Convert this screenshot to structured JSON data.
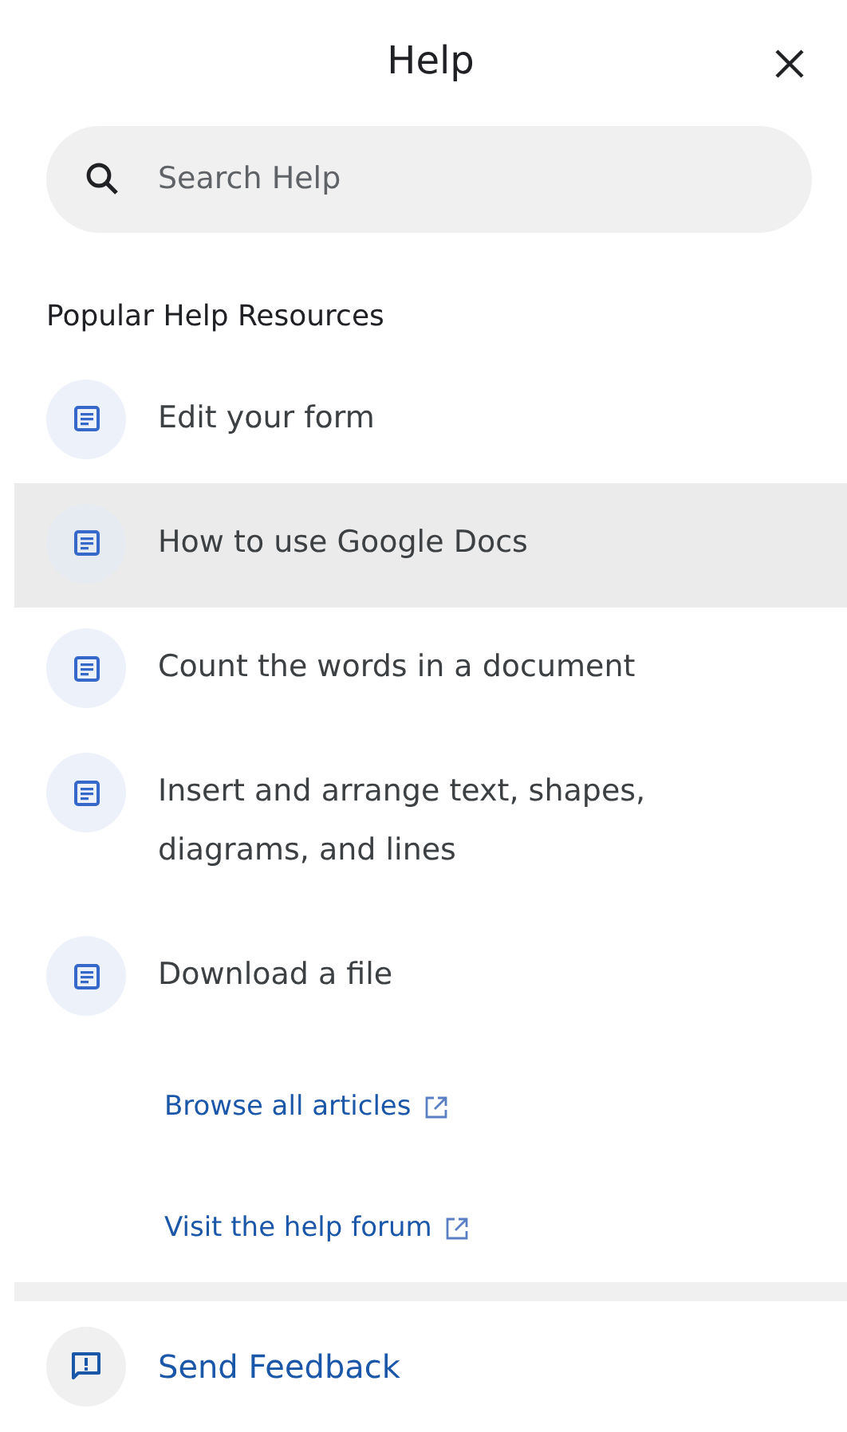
{
  "header": {
    "title": "Help"
  },
  "search": {
    "placeholder": "Search Help"
  },
  "section_title": "Popular Help Resources",
  "articles": [
    {
      "label": "Edit your form",
      "selected": false
    },
    {
      "label": "How to use Google Docs",
      "selected": true
    },
    {
      "label": "Count the words in a document",
      "selected": false
    },
    {
      "label": "Insert and arrange text, shapes, diagrams, and lines",
      "selected": false
    },
    {
      "label": "Download a file",
      "selected": false
    }
  ],
  "links": [
    "Browse all articles",
    "Visit the help forum"
  ],
  "feedback": {
    "label": "Send Feedback"
  }
}
